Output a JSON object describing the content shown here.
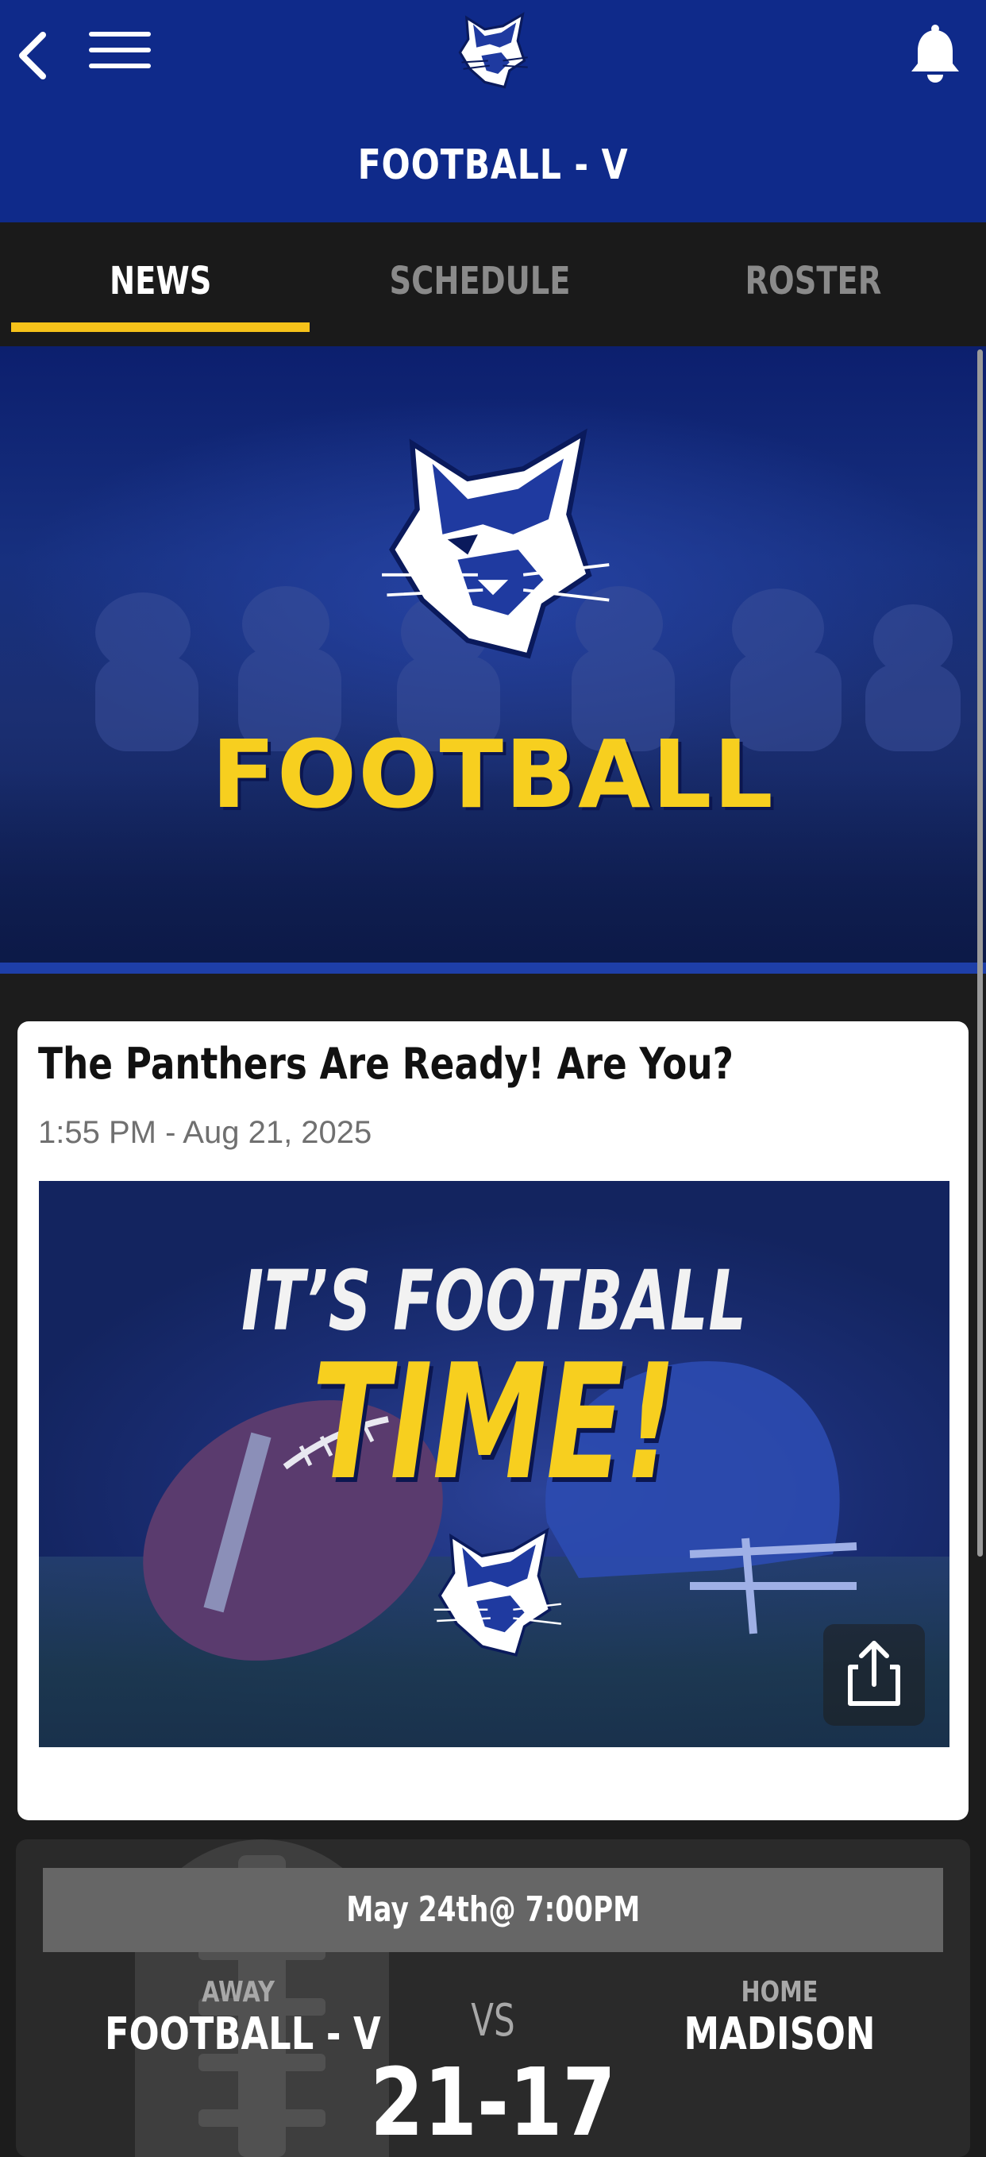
{
  "header": {
    "title": "FOOTBALL - V",
    "back_icon": "chevron-left-icon",
    "menu_icon": "hamburger-menu-icon",
    "logo": "panther-logo",
    "bell_icon": "bell-icon"
  },
  "tabs": [
    {
      "label": "NEWS",
      "active": true
    },
    {
      "label": "SCHEDULE",
      "active": false
    },
    {
      "label": "ROSTER",
      "active": false
    }
  ],
  "hero": {
    "word": "FOOTBALL"
  },
  "news": {
    "title": "The Panthers Are Ready! Are You?",
    "date": "1:55 PM - Aug 21, 2025",
    "image_line1": "IT’S FOOTBALL",
    "image_line2": "TIME!",
    "share_icon": "share-icon"
  },
  "game": {
    "datetime": "May 24th@ 7:00PM",
    "away_label": "AWAY",
    "away_team": "FOOTBALL - V",
    "vs": "VS",
    "home_label": "HOME",
    "home_team": "MADISON",
    "score": "21-17"
  },
  "colors": {
    "header_bg": "#0f2a8a",
    "accent_yellow": "#f6c21a",
    "tab_bar_bg": "#1a1a1a",
    "card_bg": "#ffffff",
    "score_card_bg": "#2a2a2a"
  }
}
